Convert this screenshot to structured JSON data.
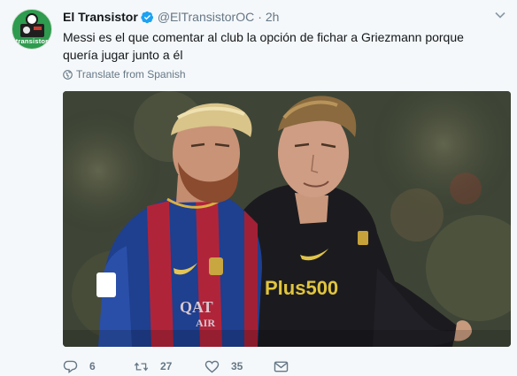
{
  "account": {
    "display_name": "El Transistor",
    "handle": "@ElTransistorOC",
    "separator": "·",
    "time": "2h",
    "avatar_text": "transistor"
  },
  "tweet": {
    "line1": "Messi es el que comentar al club la opción de fichar a Griezmann porque",
    "line2": "quería jugar junto a él",
    "translate_label": "Translate from Spanish"
  },
  "media": {
    "jersey_left_text": "QAT\nAIR",
    "jersey_right_text": "Plus500"
  },
  "actions": {
    "reply_count": "6",
    "retweet_count": "27",
    "like_count": "35"
  },
  "colors": {
    "verified": "#1da1f2",
    "text_secondary": "#657786",
    "avatar_bg": "#2e9b4e"
  }
}
